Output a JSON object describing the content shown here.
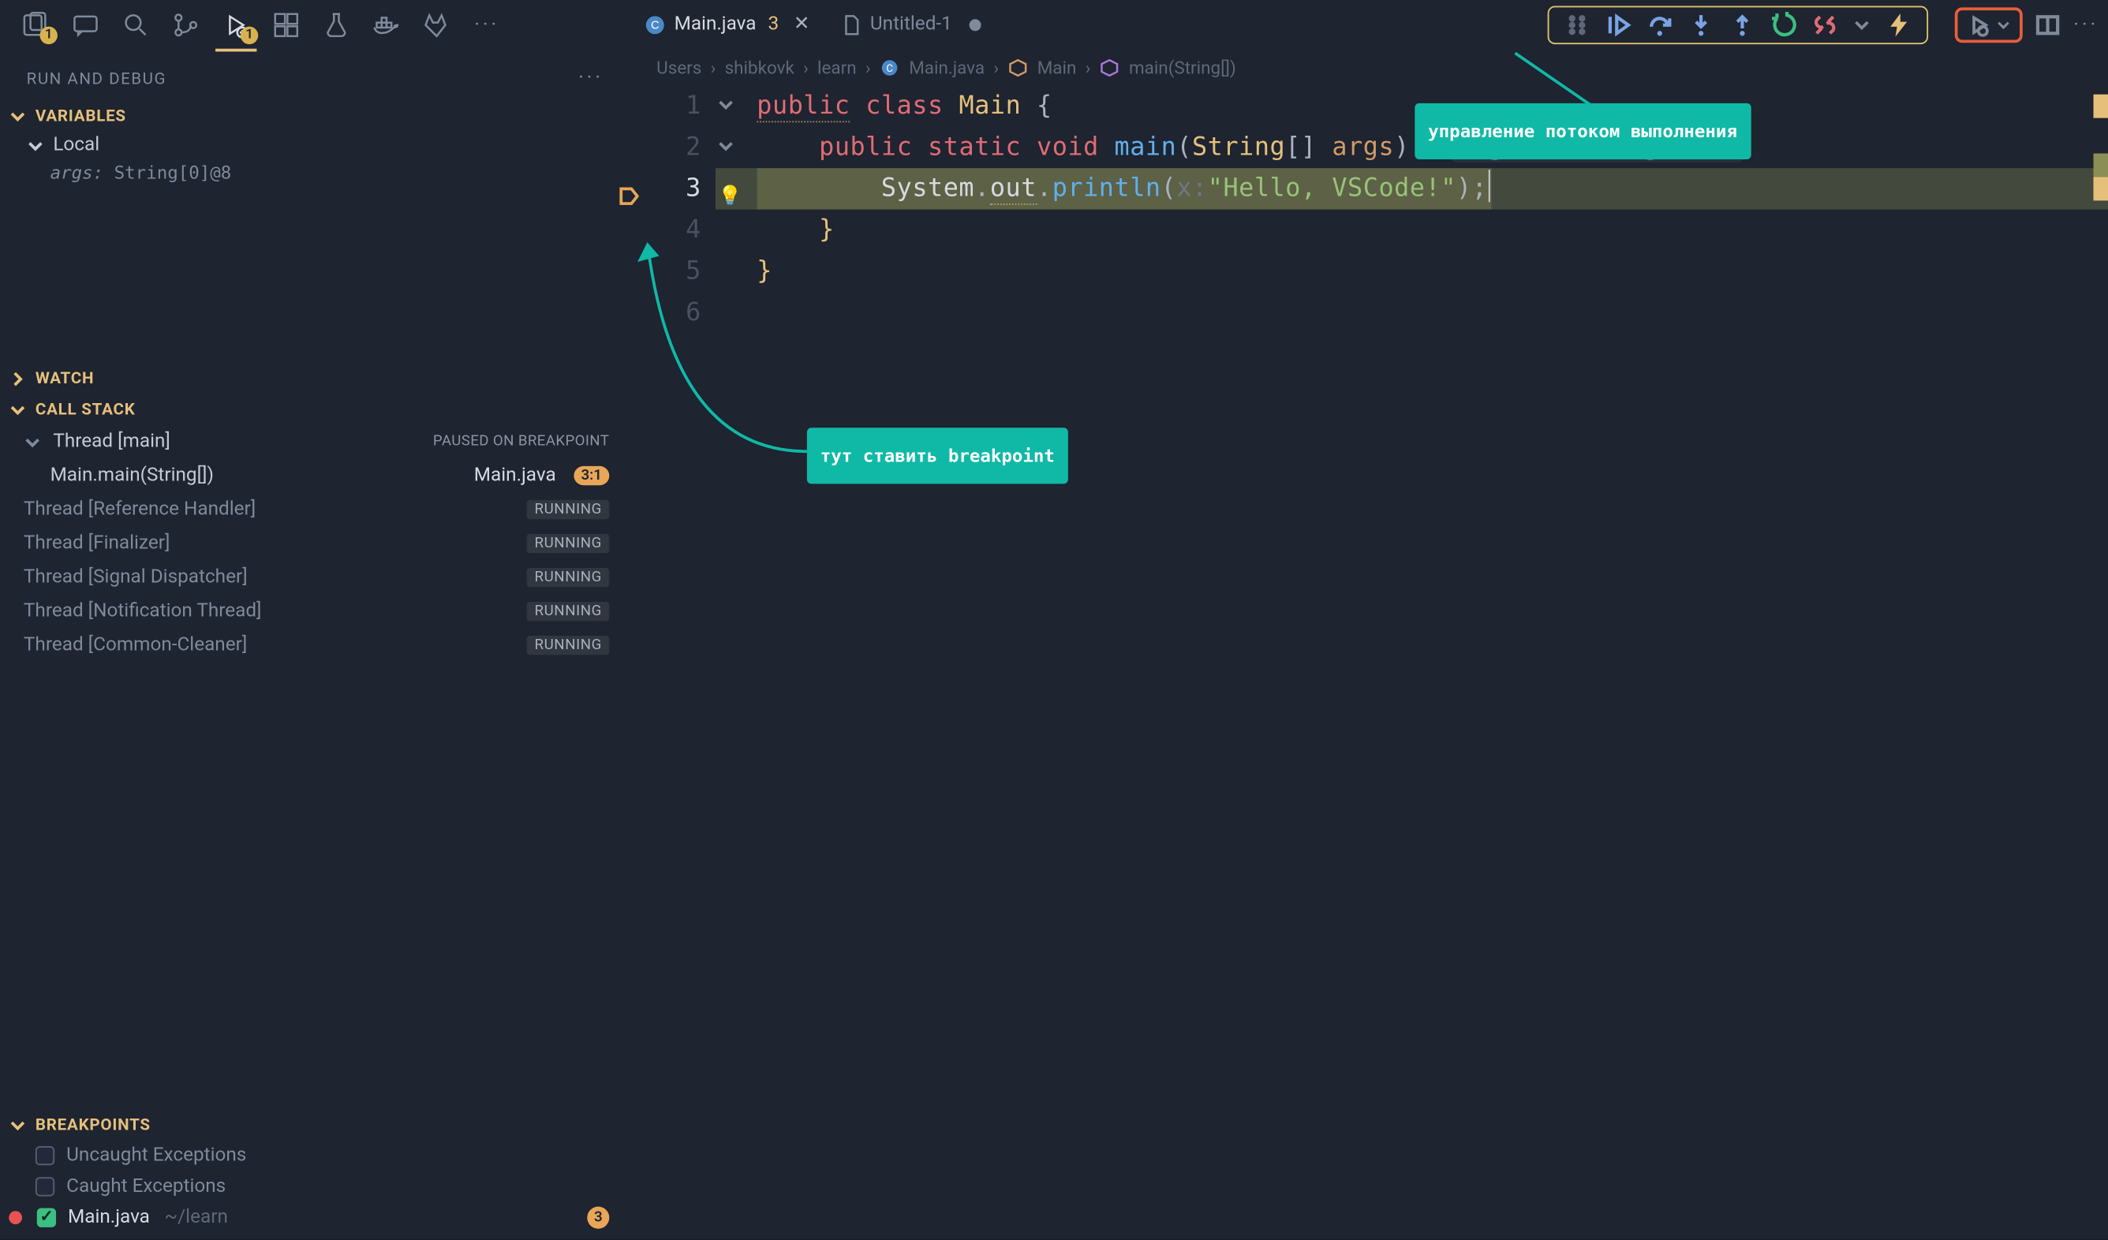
{
  "activityBar": {
    "explorerBadge": "1",
    "debugBadge": "1"
  },
  "sidebar": {
    "title": "RUN AND DEBUG",
    "sections": {
      "variables": {
        "label": "VARIABLES",
        "scope": "Local",
        "var_name": "args:",
        "var_val": "String[0]@8"
      },
      "watch": {
        "label": "WATCH"
      },
      "callstack": {
        "label": "CALL STACK",
        "mainThread": {
          "name": "Thread [main]",
          "status": "PAUSED ON BREAKPOINT"
        },
        "frame": {
          "method": "Main.main(String[])",
          "file": "Main.java",
          "pos": "3:1"
        },
        "threads": [
          {
            "name": "Thread [Reference Handler]",
            "status": "RUNNING"
          },
          {
            "name": "Thread [Finalizer]",
            "status": "RUNNING"
          },
          {
            "name": "Thread [Signal Dispatcher]",
            "status": "RUNNING"
          },
          {
            "name": "Thread [Notification Thread]",
            "status": "RUNNING"
          },
          {
            "name": "Thread [Common-Cleaner]",
            "status": "RUNNING"
          }
        ]
      },
      "breakpoints": {
        "label": "BREAKPOINTS",
        "uncaught": "Uncaught Exceptions",
        "caught": "Caught Exceptions",
        "file": {
          "name": "Main.java",
          "path": "~/learn",
          "count": "3"
        }
      }
    }
  },
  "tabs": {
    "active": {
      "name": "Main.java",
      "modified": "3"
    },
    "other": {
      "name": "Untitled-1"
    }
  },
  "debugToolbar": {
    "tooltip": "управление потоком выполнения"
  },
  "breadcrumbs": {
    "a": "Users",
    "b": "shibkovk",
    "c": "learn",
    "d": "Main.java",
    "e": "Main",
    "f": "main(String[])"
  },
  "code": {
    "l1": {
      "k1": "public",
      "k2": "class",
      "c": "Main",
      "b": "{"
    },
    "l2": {
      "k1": "public",
      "k2": "static",
      "k3": "void",
      "m": "main",
      "p1": "(",
      "ty": "String",
      "ar": "[] ",
      "arg": "args",
      "p2": ") {",
      "inlay": "args = String[0]@8"
    },
    "l3": {
      "obj": "System",
      "d1": ".",
      "f1": "out",
      "d2": ".",
      "m": "println",
      "p1": "(",
      "hint": "x:",
      "s": "\"Hello, VSCode!\"",
      "p2": ");"
    },
    "l4": {
      "b": "}"
    },
    "l5": {
      "b": "}"
    }
  },
  "num": {
    "n1": "1",
    "n2": "2",
    "n3": "3",
    "n4": "4",
    "n5": "5",
    "n6": "6"
  },
  "callouts": {
    "bp": "тут ставить breakpoint"
  }
}
